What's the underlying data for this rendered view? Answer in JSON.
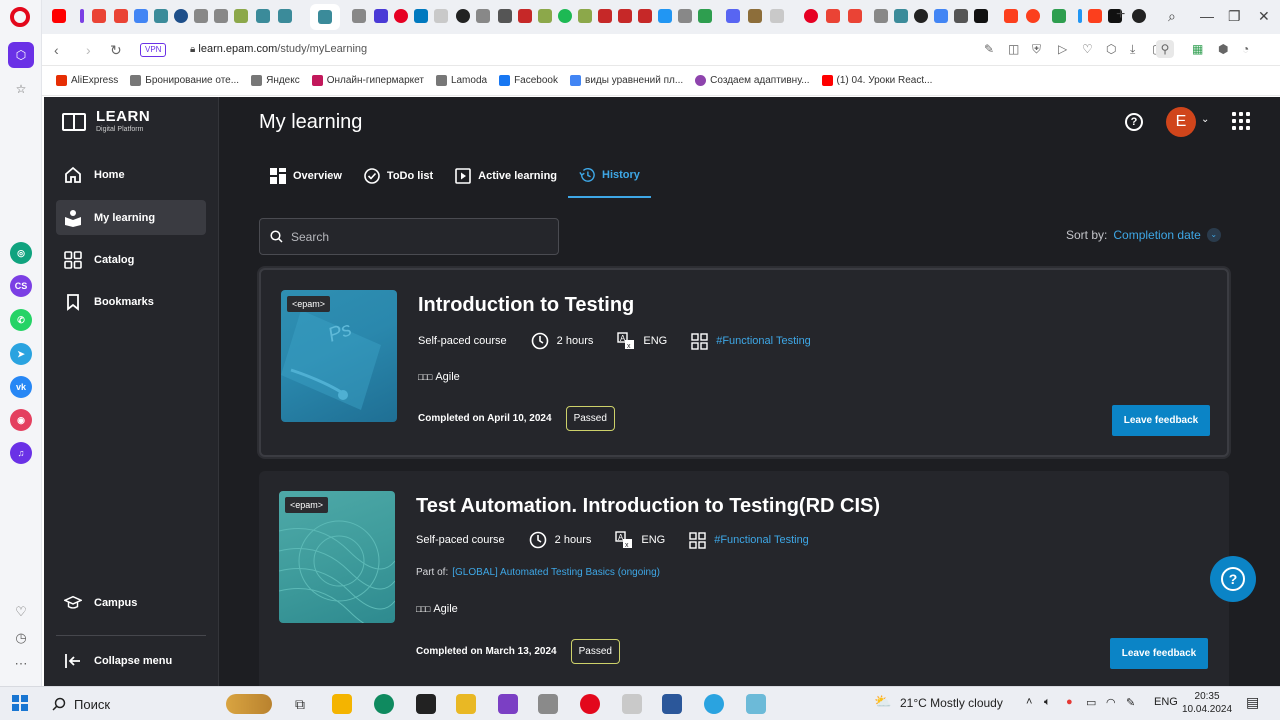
{
  "browser": {
    "url_domain": "learn.epam.com",
    "url_path": "/study/myLearning",
    "vpn_label": "VPN",
    "bookmarks": [
      {
        "label": "AliExpress",
        "color": "#e62e04"
      },
      {
        "label": "Бронирование оте...",
        "color": "#777777"
      },
      {
        "label": "Яндекс",
        "color": "#777777"
      },
      {
        "label": "Онлайн-гипермаркет",
        "color": "#c2185b"
      },
      {
        "label": "Lamoda",
        "color": "#777777"
      },
      {
        "label": "Facebook",
        "color": "#1877f2"
      },
      {
        "label": "виды уравнений пл...",
        "color": "#4285f4"
      },
      {
        "label": "Создаем адаптивну...",
        "color": "#8e44ad"
      },
      {
        "label": "(1) 04. Уроки React...",
        "color": "#ff0000"
      }
    ]
  },
  "app": {
    "brand_title": "LEARN",
    "brand_subtitle": "Digital Platform",
    "page_title": "My learning",
    "avatar_initial": "E",
    "nav": {
      "home": "Home",
      "my_learning": "My learning",
      "catalog": "Catalog",
      "bookmarks": "Bookmarks",
      "campus": "Campus",
      "collapse": "Collapse menu"
    },
    "tabs": {
      "overview": "Overview",
      "todo": "ToDo list",
      "active": "Active learning",
      "history": "History"
    },
    "search": {
      "placeholder": "Search"
    },
    "sort": {
      "label": "Sort by:",
      "value": "Completion date"
    },
    "accent_color": "#3ea7e6",
    "courses": [
      {
        "title": "Introduction to Testing",
        "type": "Self-paced course",
        "duration": "2 hours",
        "language": "ENG",
        "tag": "#Functional Testing",
        "skill_icon": "□□□",
        "skill": "Agile",
        "completed": "Completed on April 10, 2024",
        "status": "Passed",
        "feedback_label": "Leave feedback",
        "provider": "<epam>"
      },
      {
        "title": "Test Automation. Introduction to Testing(RD CIS)",
        "type": "Self-paced course",
        "duration": "2 hours",
        "language": "ENG",
        "tag": "#Functional Testing",
        "part_of_label": "Part of:",
        "part_of": "[GLOBAL] Automated Testing Basics (ongoing)",
        "skill_icon": "□□□",
        "skill": "Agile",
        "completed": "Completed on March 13, 2024",
        "status": "Passed",
        "feedback_label": "Leave feedback",
        "provider": "<epam>"
      }
    ]
  },
  "taskbar": {
    "search_label": "Поиск",
    "weather": "21°C  Mostly cloudy",
    "lang": "ENG",
    "time": "20:35",
    "date": "10.04.2024"
  }
}
